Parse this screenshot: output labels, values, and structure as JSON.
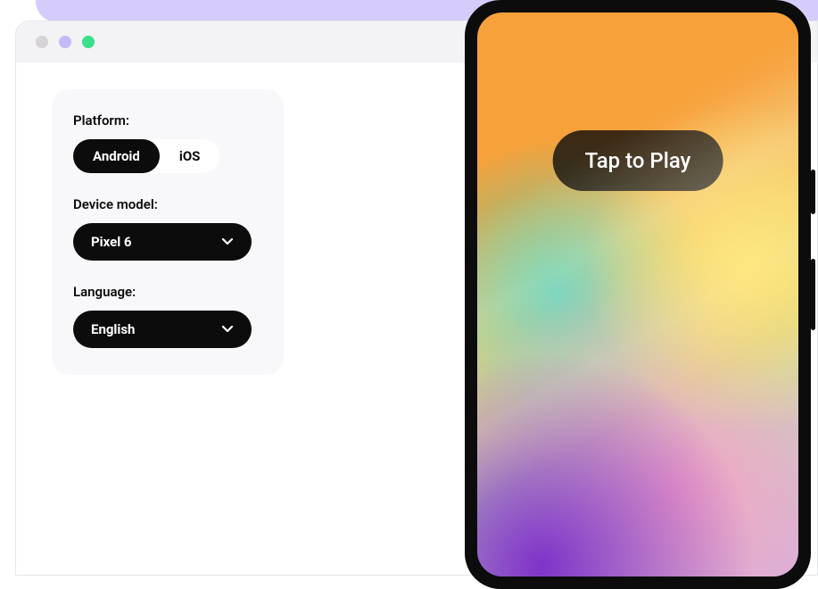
{
  "form": {
    "platform_label": "Platform:",
    "platform_options": {
      "android": "Android",
      "ios": "iOS"
    },
    "platform_selected": "android",
    "device_label": "Device model:",
    "device_selected": "Pixel 6",
    "language_label": "Language:",
    "language_selected": "English"
  },
  "phone": {
    "overlay_cta": "Tap to Play"
  }
}
